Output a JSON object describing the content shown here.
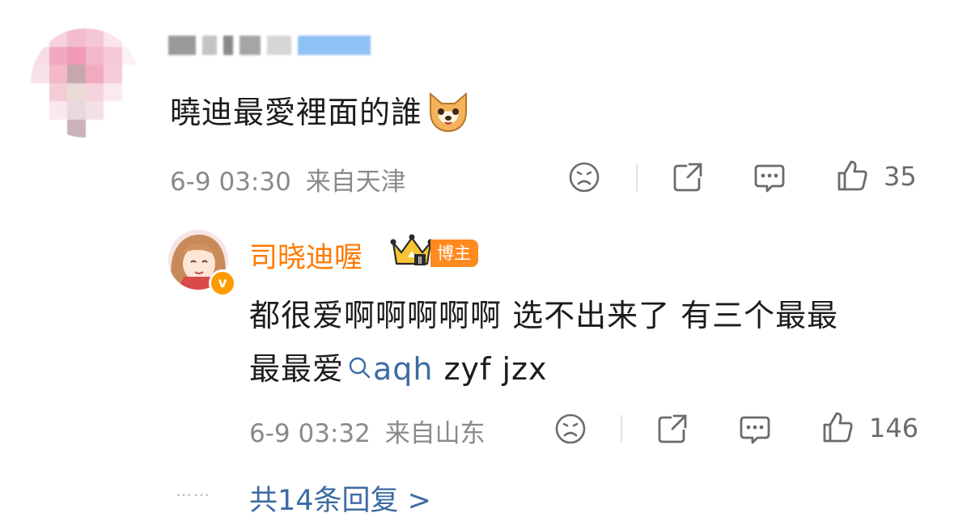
{
  "comment": {
    "text": "曉迪最愛裡面的誰",
    "time": "6-9 03:30",
    "location": "来自天津",
    "likes": "35"
  },
  "reply": {
    "author": "司晓迪喔",
    "badge": "博主",
    "crown_level": "Ⅱ",
    "verified_mark": "v",
    "line1": "都很爱啊啊啊啊啊 选不出来了 有三个最最",
    "line2_prefix": "最最爱",
    "topic_text": "aqh",
    "line2_suffix": " zyf jzx",
    "time": "6-9 03:32",
    "location": "来自山东",
    "likes": "146"
  },
  "more_replies": "共14条回复 >",
  "dots": "……",
  "colors": {
    "accent_orange": "#ff7a00",
    "link_blue": "#3d6ba3",
    "meta_gray": "#8a8a8a"
  },
  "icons": [
    "sad-face-icon",
    "share-icon",
    "comment-icon",
    "thumbs-up-icon",
    "search-icon",
    "crown-icon",
    "dog-emoji-icon"
  ]
}
